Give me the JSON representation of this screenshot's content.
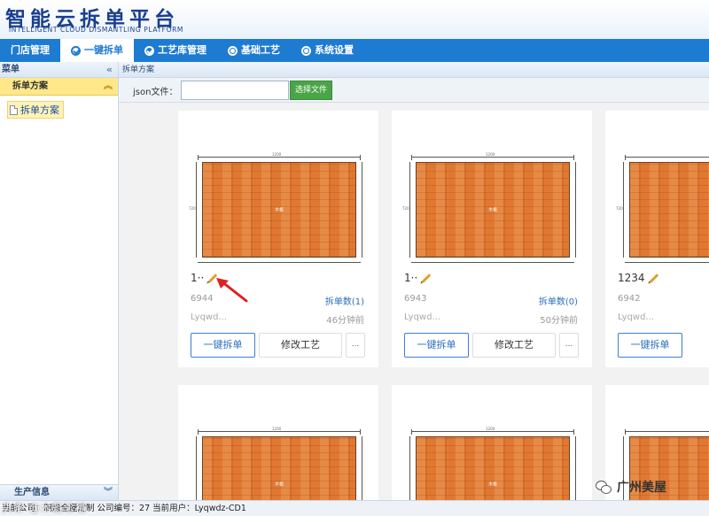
{
  "app": {
    "title_cn": "智能云拆单平台",
    "title_en": "INTELLIGENT CLOUD DISMANTLING PLATFORM"
  },
  "nav": {
    "items": [
      {
        "label": "门店管理",
        "icon": ""
      },
      {
        "label": "一键拆单",
        "icon": "check-circle-icon"
      },
      {
        "label": "工艺库管理",
        "icon": "check-circle-icon"
      },
      {
        "label": "基础工艺",
        "icon": "circle-dot-icon"
      },
      {
        "label": "系统设置",
        "icon": "circle-dot-icon"
      }
    ],
    "active_index": 1
  },
  "sidebar": {
    "header": "菜单",
    "group": "拆单方案",
    "items": [
      "拆单方案"
    ],
    "bottom": "生产信息"
  },
  "breadcrumb": "拆单方案",
  "toolbar": {
    "json_label": "json文件：",
    "json_value": "",
    "choose_button": "选择文件"
  },
  "cards": [
    {
      "name": "1··",
      "id": "6944",
      "count_text": "拆单数(1)",
      "user": "Lyqwd...",
      "time": "46分钟前",
      "split_button": "一键拆单",
      "edit_button": "修改工艺",
      "more": "..."
    },
    {
      "name": "1··",
      "id": "6943",
      "count_text": "拆单数(0)",
      "user": "Lyqwd...",
      "time": "50分钟前",
      "split_button": "一键拆单",
      "edit_button": "修改工艺",
      "more": "..."
    },
    {
      "name": "1234",
      "id": "6942",
      "count_text": "",
      "user": "Lyqwd...",
      "time": "",
      "split_button": "一键拆单",
      "edit_button": "",
      "more": ""
    }
  ],
  "thumbnail": {
    "width_label": "1200",
    "height_label": "720",
    "board_label": "木板"
  },
  "status": {
    "text": "当前公司：制燥全屋定制    公司编号：27    当前用户：Lyqwdz-CD1"
  },
  "watermarks": {
    "left": "头条 @木魁验福",
    "right": "广州美屋"
  },
  "colors": {
    "nav_bg": "#1e7bd2",
    "accent_green": "#49a547",
    "board_orange": "#e07832",
    "link_blue": "#2a6fbf",
    "arrow_red": "#e02020"
  }
}
